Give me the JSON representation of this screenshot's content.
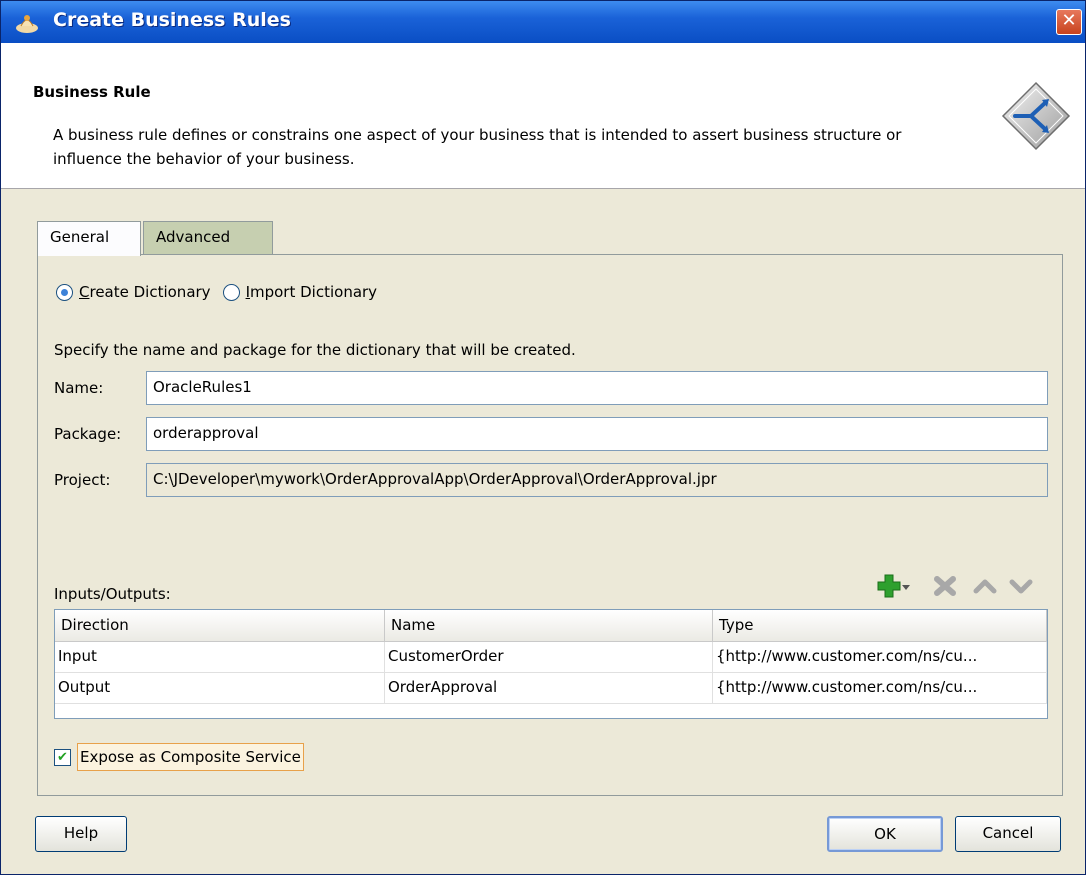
{
  "window": {
    "title": "Create Business Rules"
  },
  "header": {
    "title": "Business Rule",
    "description": "A business rule defines or constrains one aspect of your business that is intended to assert business structure or influence the behavior of your business."
  },
  "tabs": [
    {
      "label": "General",
      "active": true
    },
    {
      "label": "Advanced",
      "active": false
    }
  ],
  "dictionary": {
    "create_label": "Create Dictionary",
    "create_mnemonic": "C",
    "import_label": "Import Dictionary",
    "import_mnemonic": "I",
    "selected": "create"
  },
  "instructions": "Specify the name and package for the dictionary that will be created.",
  "fields": {
    "name_label": "Name:",
    "name_value": "OracleRules1",
    "package_label": "Package:",
    "package_value": "orderapproval",
    "project_label": "Project:",
    "project_value": "C:\\JDeveloper\\mywork\\OrderApprovalApp\\OrderApproval\\OrderApproval.jpr"
  },
  "io": {
    "label": "Inputs/Outputs:",
    "columns": [
      "Direction",
      "Name",
      "Type"
    ],
    "rows": [
      [
        "Input",
        "CustomerOrder",
        "{http://www.customer.com/ns/cu..."
      ],
      [
        "Output",
        "OrderApproval",
        "{http://www.customer.com/ns/cu..."
      ]
    ]
  },
  "expose": {
    "label": "Expose as Composite Service",
    "checked": true
  },
  "buttons": {
    "help": "Help",
    "ok": "OK",
    "cancel": "Cancel"
  },
  "colors": {
    "titlebar": "#1a62d8",
    "add_icon": "#2ea02e",
    "disabled_icon": "#a8a8a8"
  }
}
